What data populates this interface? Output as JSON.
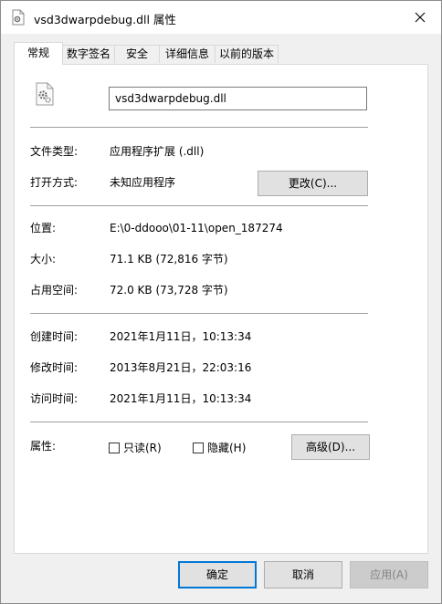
{
  "window": {
    "title": "vsd3dwarpdebug.dll 属性",
    "close_glyph": "✕"
  },
  "tabs": [
    {
      "label": "常规",
      "active": true
    },
    {
      "label": "数字签名",
      "active": false
    },
    {
      "label": "安全",
      "active": false
    },
    {
      "label": "详细信息",
      "active": false
    },
    {
      "label": "以前的版本",
      "active": false
    }
  ],
  "general": {
    "file_name": "vsd3dwarpdebug.dll",
    "file_type": {
      "label": "文件类型:",
      "value": "应用程序扩展 (.dll)"
    },
    "opens_with": {
      "label": "打开方式:",
      "value": "未知应用程序",
      "change_button": "更改(C)..."
    },
    "location": {
      "label": "位置:",
      "value": "E:\\0-ddooo\\01-11\\open_187274"
    },
    "size": {
      "label": "大小:",
      "value": "71.1 KB (72,816 字节)"
    },
    "size_on_disk": {
      "label": "占用空间:",
      "value": "72.0 KB (73,728 字节)"
    },
    "created": {
      "label": "创建时间:",
      "value": "2021年1月11日，10:13:34"
    },
    "modified": {
      "label": "修改时间:",
      "value": "2013年8月21日，22:03:16"
    },
    "accessed": {
      "label": "访问时间:",
      "value": "2021年1月11日，10:13:34"
    },
    "attributes": {
      "label": "属性:",
      "readonly": {
        "label": "只读(R)",
        "checked": false
      },
      "hidden": {
        "label": "隐藏(H)",
        "checked": false
      },
      "advanced_button": "高级(D)..."
    }
  },
  "footer": {
    "ok": "确定",
    "cancel": "取消",
    "apply": "应用(A)"
  },
  "icons": {
    "title": "dll-file-icon",
    "file": "dll-gear-file-icon",
    "close": "close-icon"
  }
}
